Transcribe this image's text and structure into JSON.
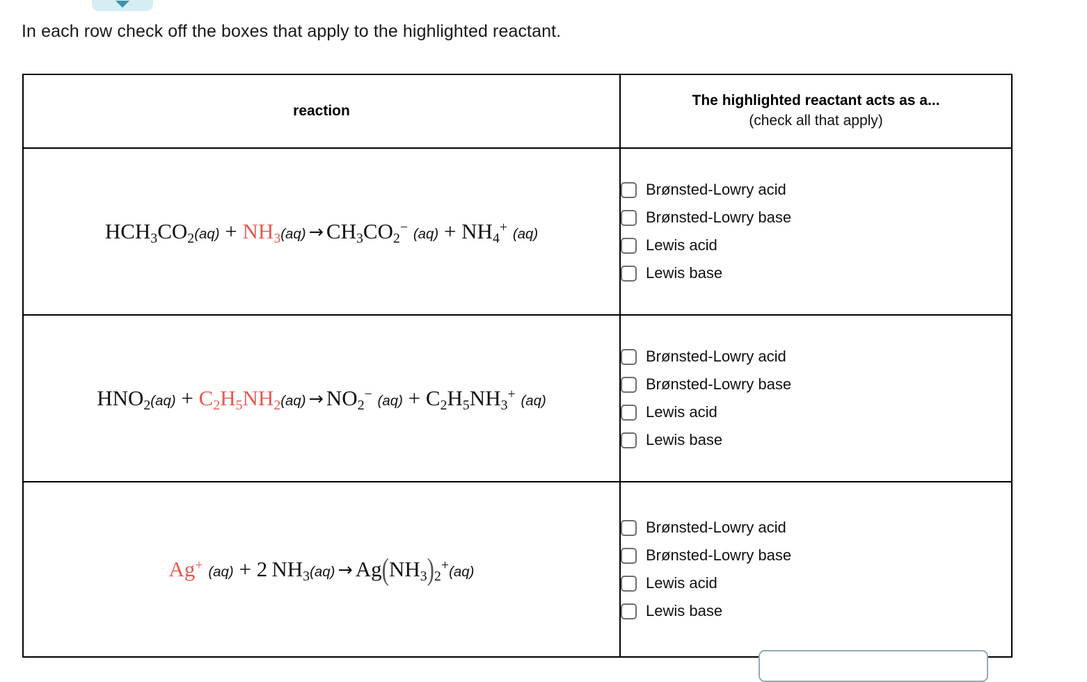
{
  "top_control": {
    "name": "collapsed-dropdown-pill",
    "icon": "chevron-down-icon",
    "color": "#d6eef3",
    "icon_color": "#3d93ab"
  },
  "instruction": "In each row check off the boxes that apply to the highlighted reactant.",
  "table": {
    "headers": {
      "reaction": "reaction",
      "checks_main": "The highlighted reactant acts as a...",
      "checks_sub": "(check all that apply)"
    },
    "highlight_color": "#e8594f",
    "checkbox_options": [
      "Brønsted-Lowry acid",
      "Brønsted-Lowry base",
      "Lewis acid",
      "Lewis base"
    ],
    "rows": [
      {
        "id": "row-1",
        "reaction_text": "HCH3CO2(aq) + NH3(aq) → CH3CO2−(aq) + NH4+(aq)",
        "highlighted_reactant": "NH3",
        "options": [
          {
            "label": "Brønsted-Lowry acid",
            "checked": false
          },
          {
            "label": "Brønsted-Lowry base",
            "checked": false
          },
          {
            "label": "Lewis acid",
            "checked": false
          },
          {
            "label": "Lewis base",
            "checked": false
          }
        ]
      },
      {
        "id": "row-2",
        "reaction_text": "HNO2(aq) + C2H5NH2(aq) → NO2−(aq) + C2H5NH3+(aq)",
        "highlighted_reactant": "C2H5NH2",
        "options": [
          {
            "label": "Brønsted-Lowry acid",
            "checked": false
          },
          {
            "label": "Brønsted-Lowry base",
            "checked": false
          },
          {
            "label": "Lewis acid",
            "checked": false
          },
          {
            "label": "Lewis base",
            "checked": false
          }
        ]
      },
      {
        "id": "row-3",
        "reaction_text": "Ag+(aq) + 2 NH3(aq) → Ag(NH3)2+(aq)",
        "highlighted_reactant": "Ag+",
        "options": [
          {
            "label": "Brønsted-Lowry acid",
            "checked": false
          },
          {
            "label": "Brønsted-Lowry base",
            "checked": false
          },
          {
            "label": "Lewis acid",
            "checked": false
          },
          {
            "label": "Lewis base",
            "checked": false
          }
        ]
      }
    ]
  },
  "bottom_control": {
    "name": "partially-visible-button"
  }
}
